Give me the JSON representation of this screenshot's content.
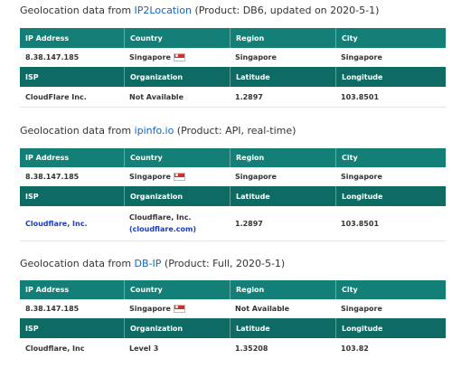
{
  "sections": [
    {
      "title_prefix": "Geolocation data from ",
      "provider": "IP2Location",
      "title_suffix": " (Product: DB6, updated on 2020-5-1)",
      "headers1": [
        "IP Address",
        "Country",
        "Region",
        "City"
      ],
      "row1": [
        "8.38.147.185",
        "Singapore",
        "Singapore",
        "Singapore"
      ],
      "headers2": [
        "ISP",
        "Organization",
        "Latitude",
        "Longitude"
      ],
      "row2": [
        "CloudFlare Inc.",
        "Not Available",
        "1.2897",
        "103.8501"
      ]
    },
    {
      "title_prefix": "Geolocation data from ",
      "provider": "ipinfo.io",
      "title_suffix": " (Product: API, real-time)",
      "headers1": [
        "IP Address",
        "Country",
        "Region",
        "City"
      ],
      "row1": [
        "8.38.147.185",
        "Singapore",
        "Singapore",
        "Singapore"
      ],
      "headers2": [
        "ISP",
        "Organization",
        "Latitude",
        "Longitude"
      ],
      "row2": [
        "Cloudflare, Inc.",
        "Cloudflare, Inc.",
        "1.2897",
        "103.8501"
      ],
      "org_link": "(cloudflare.com)"
    },
    {
      "title_prefix": "Geolocation data from ",
      "provider": "DB-IP",
      "title_suffix": " (Product: Full, 2020-5-1)",
      "headers1": [
        "IP Address",
        "Country",
        "Region",
        "City"
      ],
      "row1": [
        "8.38.147.185",
        "Singapore",
        "Not Available",
        "Singapore"
      ],
      "headers2": [
        "ISP",
        "Organization",
        "Latitude",
        "Longitude"
      ],
      "row2": [
        "Cloudflare, Inc",
        "Level 3",
        "1.35208",
        "103.82"
      ]
    }
  ],
  "colors": {
    "header": "#137f76",
    "header_dark": "#0e6b64",
    "link": "#1565c0"
  },
  "flag_icon": "singapore-flag-icon"
}
